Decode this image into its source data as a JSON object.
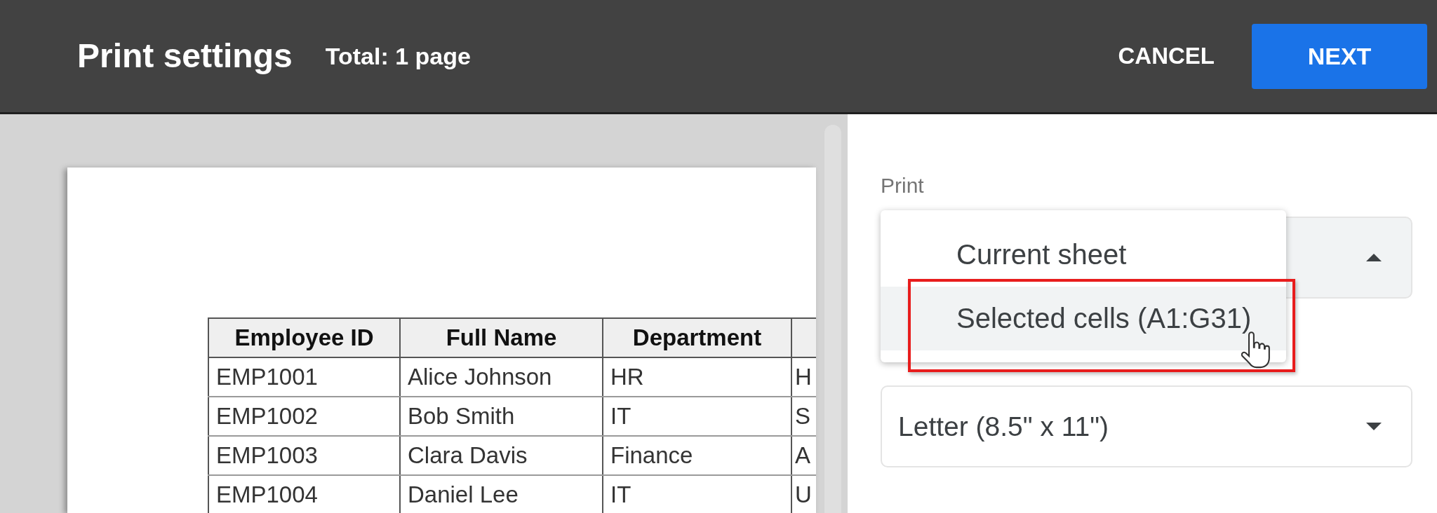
{
  "header": {
    "title": "Print settings",
    "total": "Total: 1 page",
    "buttons": [
      {
        "label": "CANCEL",
        "kind": "text"
      },
      {
        "label": "NEXT",
        "kind": "primary"
      }
    ]
  },
  "preview": {
    "table": {
      "columns": [
        "Employee ID",
        "Full Name",
        "Department"
      ],
      "rows": [
        [
          "EMP1001",
          "Alice Johnson",
          "HR",
          "H"
        ],
        [
          "EMP1002",
          "Bob Smith",
          "IT",
          "S"
        ],
        [
          "EMP1003",
          "Clara Davis",
          "Finance",
          "A"
        ],
        [
          "EMP1004",
          "Daniel Lee",
          "IT",
          "U"
        ]
      ]
    }
  },
  "settings": {
    "print": {
      "label": "Print",
      "expanded": true,
      "options": [
        {
          "label": "Current sheet",
          "selected": false
        },
        {
          "label": "Selected cells (A1:G31)",
          "selected": true
        }
      ]
    },
    "paper_size": {
      "value": "Letter (8.5\" x 11\")",
      "expanded": false
    }
  }
}
